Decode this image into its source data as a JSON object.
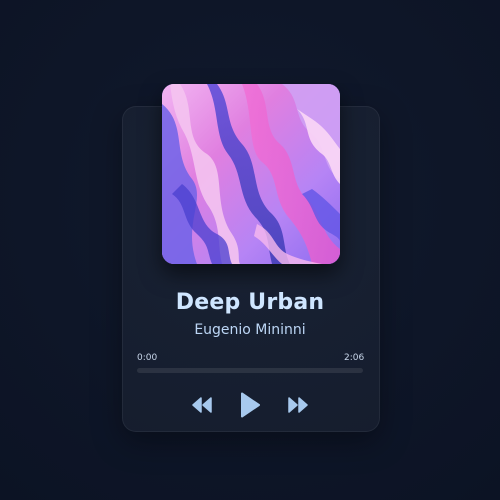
{
  "player": {
    "track_title": "Deep Urban",
    "artist": "Eugenio Mininni",
    "time_current": "0:00",
    "time_total": "2:06",
    "progress_fraction": 0.0
  },
  "controls": {
    "rewind_icon": "rewind-icon",
    "play_icon": "play-icon",
    "forward_icon": "fast-forward-icon"
  },
  "colors": {
    "background": "#0f172a",
    "card": "#141c2e",
    "title": "#cfe6ff",
    "controls": "#a7c9ee"
  }
}
